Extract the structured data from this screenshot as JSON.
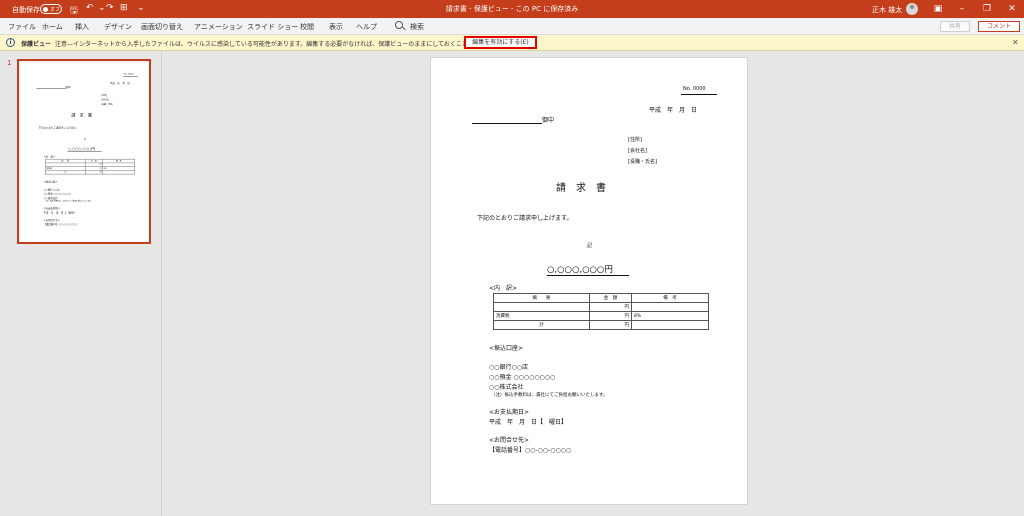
{
  "titlebar": {
    "autosave_label": "自動保存",
    "autosave_state": "オフ",
    "document_title": "請求書 - 保護ビュー - この PC に保存済み",
    "user_name": "正木 雄太",
    "accent_color": "#c43e1c"
  },
  "ribbon": {
    "tabs": [
      "ファイル",
      "ホーム",
      "挿入",
      "デザイン",
      "画面切り替え",
      "アニメーション",
      "スライド ショー",
      "校閲",
      "表示",
      "ヘルプ"
    ],
    "search_label": "検索",
    "share_label": "共有",
    "comment_label": "コメント"
  },
  "protected_view": {
    "title": "保護ビュー",
    "message": "注意—インターネットから入手したファイルは、ウイルスに感染している可能性があります。編集する必要がなければ、保護ビューのままにしておくことをお勧めします。",
    "enable_button": "編集を有効にする(E)"
  },
  "thumbnails": {
    "slide_number": "1"
  },
  "invoice": {
    "number": "No. 0000",
    "date": "平成　年　月　日",
    "recipient_honorific": "御中",
    "address_label": "[住所]",
    "company_label": "[会社名]",
    "person_label": "[役職・氏名]",
    "title": "請　求　書",
    "intro": "下記のとおりご請求申し上げます。",
    "ki": "記",
    "total": "○,○○○,○○○円",
    "breakdown_label": "<内　訳>",
    "table_headers": [
      "摘　　要",
      "金　額",
      "備　考"
    ],
    "rows": [
      {
        "label": "",
        "yen": "円",
        "note": ""
      },
      {
        "label": "消費税",
        "yen": "円",
        "note": "8%"
      },
      {
        "label": "計",
        "yen": "円",
        "note": ""
      }
    ],
    "bank_label": "<振込口座>",
    "bank_lines": [
      "○○銀行○○店",
      "○○預金 ○○○○○○○○",
      "○○株式会社"
    ],
    "bank_note": "（注）振込手数料は、貴社にてご負担お願いいたします。",
    "due_label": "<お支払期日>",
    "due_value": "平成　年　月　日【　曜日】",
    "contact_label": "<お問合せ先>",
    "contact_value": "【電話番号】○○-○○-○○○○"
  }
}
